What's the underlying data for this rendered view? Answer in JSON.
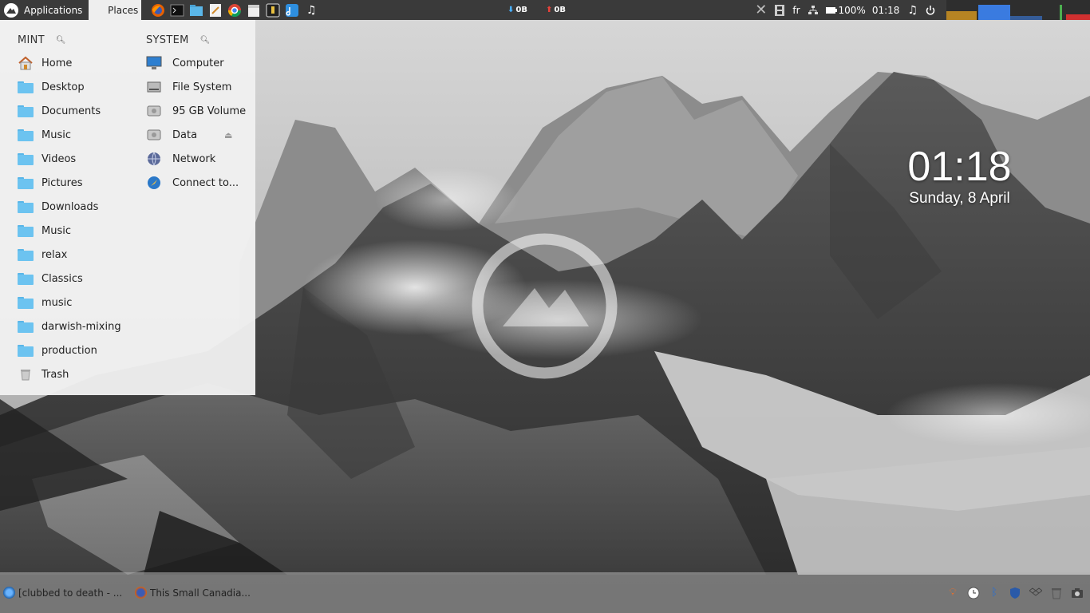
{
  "top_panel": {
    "applications_label": "Applications",
    "places_label": "Places",
    "launchers": [
      "firefox-icon",
      "terminal-icon",
      "files-icon",
      "text-editor-icon",
      "chrome-icon",
      "calendar-icon",
      "security-icon",
      "store-icon",
      "music-icon"
    ],
    "net_down": "0B",
    "net_up": "0B",
    "keyboard_layout": "fr",
    "battery": "100%",
    "time": "01:18"
  },
  "places": {
    "mint_header": "MINT",
    "system_header": "SYSTEM",
    "mint_items": [
      {
        "label": "Home",
        "icon": "home-icon"
      },
      {
        "label": "Desktop",
        "icon": "folder-icon"
      },
      {
        "label": "Documents",
        "icon": "folder-icon"
      },
      {
        "label": "Music",
        "icon": "folder-icon"
      },
      {
        "label": "Videos",
        "icon": "folder-icon"
      },
      {
        "label": "Pictures",
        "icon": "folder-icon"
      },
      {
        "label": "Downloads",
        "icon": "folder-icon"
      },
      {
        "label": "Music",
        "icon": "folder-icon"
      },
      {
        "label": "relax",
        "icon": "folder-icon"
      },
      {
        "label": "Classics",
        "icon": "folder-icon"
      },
      {
        "label": "music",
        "icon": "folder-icon"
      },
      {
        "label": "darwish-mixing",
        "icon": "folder-icon"
      },
      {
        "label": "production",
        "icon": "folder-icon"
      },
      {
        "label": "Trash",
        "icon": "trash-icon"
      }
    ],
    "system_items": [
      {
        "label": "Computer",
        "icon": "computer-icon"
      },
      {
        "label": "File System",
        "icon": "drive-icon"
      },
      {
        "label": "95 GB Volume",
        "icon": "drive-icon"
      },
      {
        "label": "Data",
        "icon": "drive-icon"
      },
      {
        "label": "Network",
        "icon": "network-icon"
      },
      {
        "label": "Connect to...",
        "icon": "connect-icon"
      }
    ]
  },
  "clock_widget": {
    "time": "01:18",
    "date": "Sunday, 8 April"
  },
  "taskbar": {
    "tasks": [
      {
        "label": "[clubbed to death - ...",
        "icon": "browser-icon"
      },
      {
        "label": "This Small Canadia...",
        "icon": "firefox-icon"
      }
    ]
  },
  "colors": {
    "panel": "#3a3a3a",
    "folder": "#6cc3f0",
    "menu_bg": "#f0f0f0"
  }
}
